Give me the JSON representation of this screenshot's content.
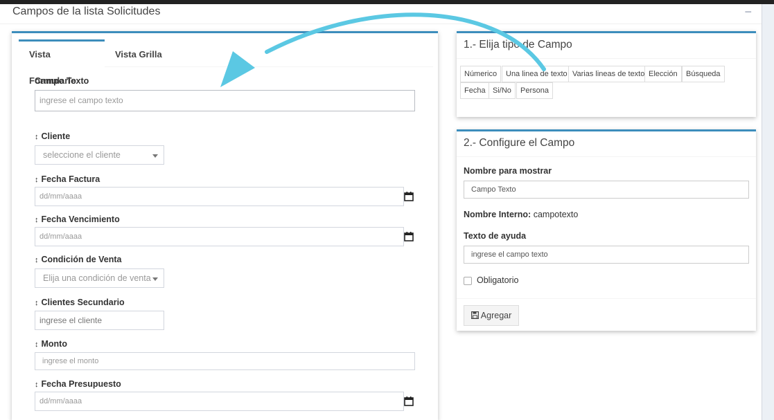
{
  "outer": {
    "title": "Campos de la lista Solicitudes",
    "collapse": "−"
  },
  "tabs": [
    "Vista Formulario",
    "Vista Grilla"
  ],
  "form": {
    "campo_texto": {
      "label": "Campo Texto",
      "placeholder": "ingrese el campo texto"
    },
    "fields": [
      {
        "label": "Cliente",
        "value": "seleccione el cliente"
      },
      {
        "label": "Fecha Factura",
        "value": "dd/mm/aaaa"
      },
      {
        "label": "Fecha Vencimiento",
        "value": "dd/mm/aaaa"
      },
      {
        "label": "Condición de Venta",
        "value": "Elija una condición de venta"
      },
      {
        "label": "Clientes Secundario",
        "value": "ingrese el cliente"
      },
      {
        "label": "Monto",
        "value": "ingrese el monto"
      },
      {
        "label": "Fecha Presupuesto",
        "value": "dd/mm/aaaa"
      }
    ],
    "sort_glyph": "↕"
  },
  "panel1": {
    "title": "1.- Elija tipo de Campo",
    "types": [
      "Númerico",
      "Una linea de texto",
      "Varias lineas de texto",
      "Elección",
      "Búsqueda",
      "Fecha",
      "Si/No",
      "Persona"
    ]
  },
  "panel2": {
    "title": "2.- Configure el Campo",
    "nombre_label": "Nombre para mostrar",
    "nombre_value": "Campo Texto",
    "interno_label": "Nombre Interno:",
    "interno_value": "campotexto",
    "ayuda_label": "Texto de ayuda",
    "ayuda_value": "ingrese el campo texto",
    "obligatorio": "Obligatorio",
    "add_label": "Agregar"
  },
  "colors": {
    "accent": "#3c8dbc",
    "arrow": "#5bc8e3"
  }
}
